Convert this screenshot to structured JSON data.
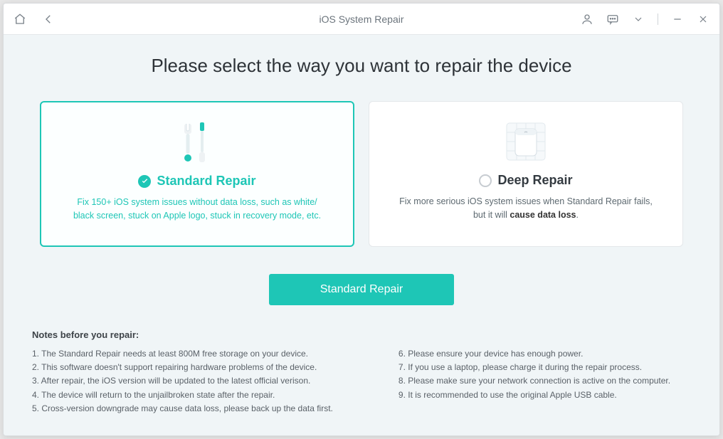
{
  "titlebar": {
    "title": "iOS System Repair"
  },
  "heading": "Please select the way you want to repair the device",
  "cards": {
    "standard": {
      "title": "Standard Repair",
      "desc_line1": "Fix 150+ iOS system issues without data loss, such as white/",
      "desc_line2": "black screen, stuck on Apple logo, stuck in recovery mode, etc."
    },
    "deep": {
      "title": "Deep Repair",
      "desc_prefix": "Fix more serious iOS system issues when Standard Repair fails,",
      "desc_line2a": "but it will ",
      "desc_bold": "cause data loss",
      "desc_line2b": "."
    }
  },
  "action_label": "Standard Repair",
  "notes": {
    "title": "Notes before you repair:",
    "left": [
      "1.  The Standard Repair needs at least 800M free storage on your device.",
      "2.  This software doesn't support repairing hardware problems of the device.",
      "3.  After repair, the iOS version will be updated to the latest official verison.",
      "4.  The device will return to the unjailbroken state after the repair.",
      "5.  Cross-version downgrade may cause data loss, please back up the data first."
    ],
    "right": [
      "6.  Please ensure your device has enough power.",
      "7.  If you use a laptop, please charge it during the repair process.",
      "8.  Please make sure your network connection is active on the computer.",
      "9.  It is recommended to use the original Apple USB cable."
    ]
  }
}
